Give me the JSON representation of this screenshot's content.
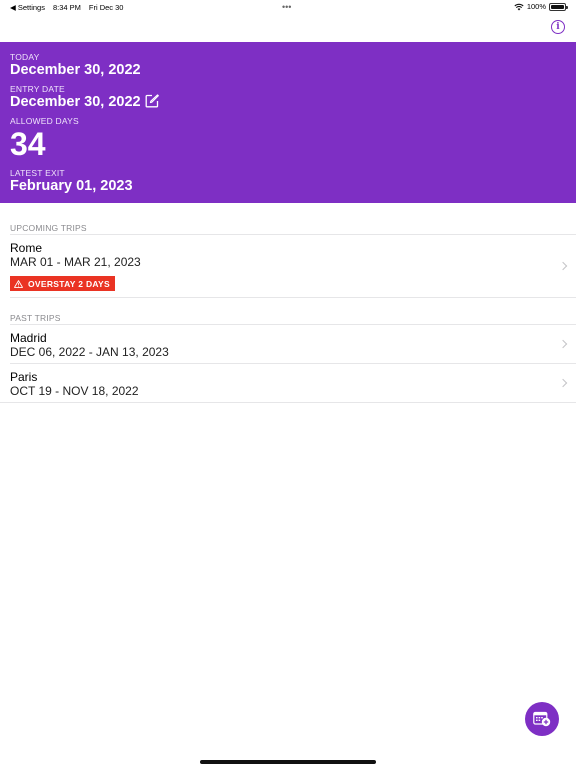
{
  "status_bar": {
    "back_app": "◀ Settings",
    "time": "8:34 PM",
    "date": "Fri Dec 30",
    "dots": "•••",
    "battery": "100%"
  },
  "header": {
    "today_label": "TODAY",
    "today_value": "December 30, 2022",
    "entry_label": "ENTRY DATE",
    "entry_value": "December 30, 2022",
    "allowed_label": "ALLOWED DAYS",
    "allowed_value": "34",
    "exit_label": "LATEST EXIT",
    "exit_value": "February 01, 2023"
  },
  "upcoming": {
    "section_title": "UPCOMING TRIPS",
    "trips": [
      {
        "city": "Rome",
        "dates": "MAR 01 - MAR 21, 2023",
        "badge": "OVERSTAY 2 DAYS"
      }
    ]
  },
  "past": {
    "section_title": "PAST TRIPS",
    "trips": [
      {
        "city": "Madrid",
        "dates": "DEC 06, 2022 - JAN 13, 2023"
      },
      {
        "city": "Paris",
        "dates": "OCT 19 - NOV 18, 2022"
      }
    ]
  },
  "colors": {
    "accent": "#7e2fc4",
    "warning": "#ea3323"
  },
  "icons": {
    "info": "info-circle-icon",
    "edit": "edit-pencil-icon",
    "warning": "warning-triangle-icon",
    "fab": "calendar-add-icon"
  }
}
